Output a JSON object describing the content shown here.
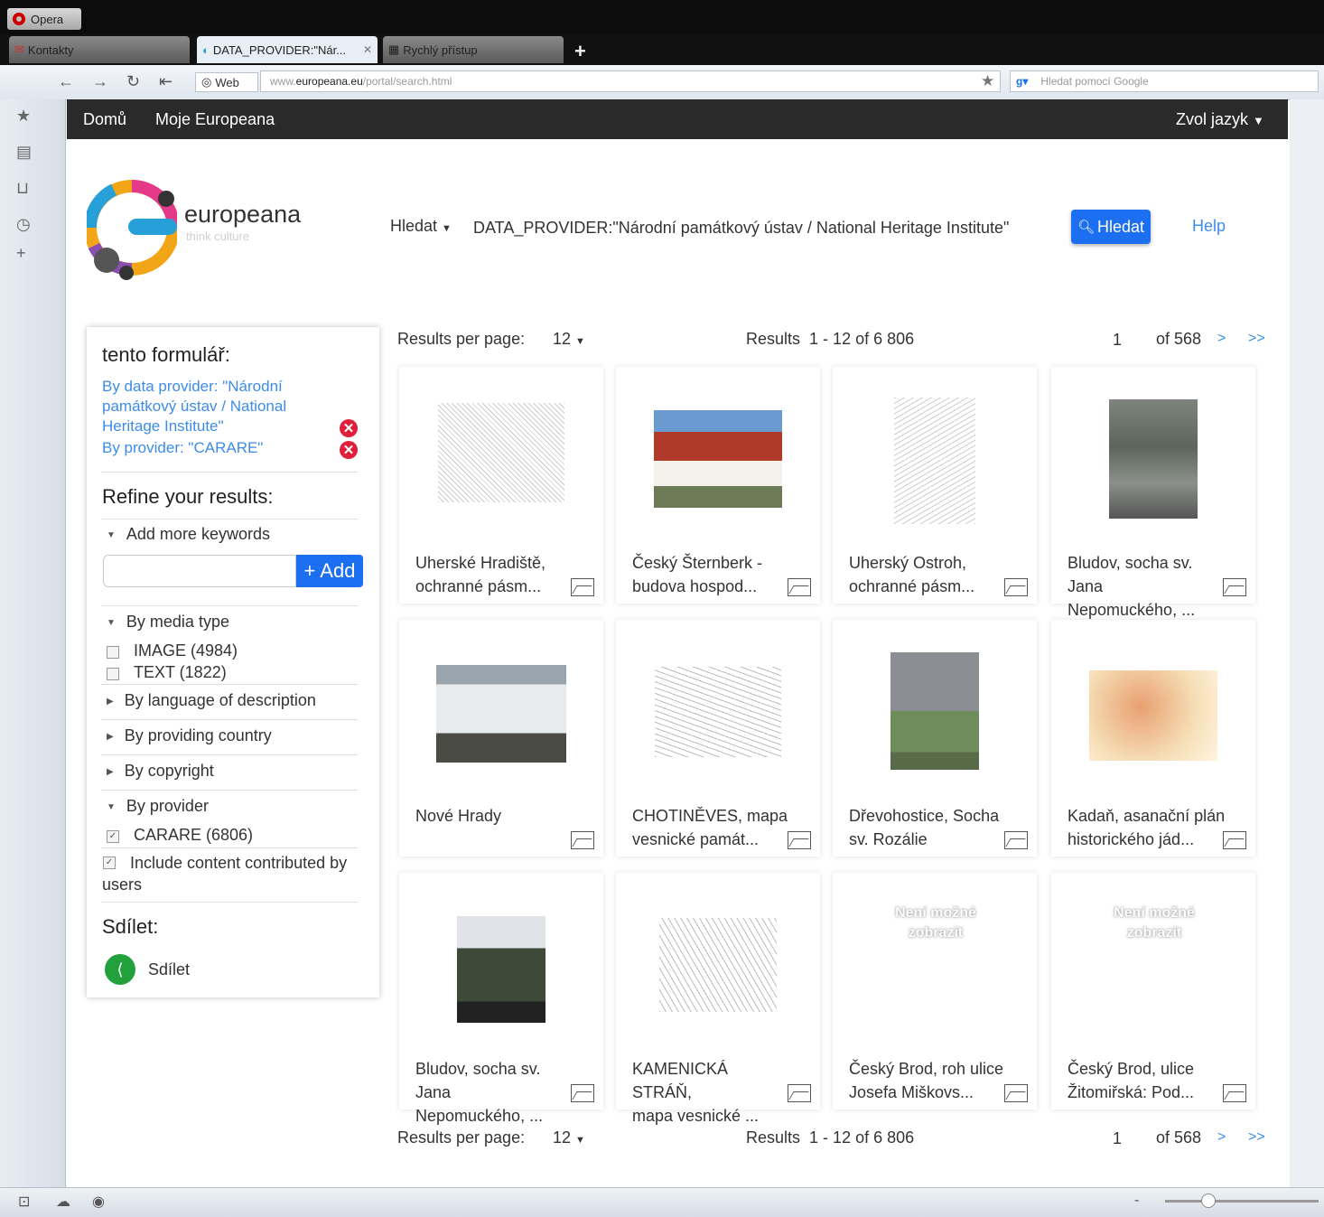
{
  "browser": {
    "app_name": "Opera",
    "tabs": [
      {
        "label": "Kontakty"
      },
      {
        "label": "DATA_PROVIDER:\"Nár..."
      },
      {
        "label": "Rychlý přístup"
      }
    ],
    "web_badge": "Web",
    "url_prefix": "www.",
    "url_domain": "europeana.eu",
    "url_path": "/portal/search.html",
    "search_placeholder": "Hledat pomocí Google"
  },
  "sitenav": {
    "home": "Domů",
    "my": "Moje Europeana",
    "language": "Zvol jazyk"
  },
  "logo": {
    "word": "europeana",
    "tagline": "think culture"
  },
  "search": {
    "scope_label": "Hledat",
    "query": "DATA_PROVIDER:\"Národní památkový ústav / National Heritage Institute\"",
    "button": "Hledat",
    "help": "Help"
  },
  "left_panel": {
    "form_title": "tento formulář:",
    "filter_1": "By data provider: \"Národní památkový ústav / National Heritage Institute\"",
    "filter_2": "By provider: \"CARARE\"",
    "refine_title": "Refine your results:",
    "add_keywords": "Add more keywords",
    "add_button": "+ Add",
    "media_type": "By media type",
    "image_opt": "IMAGE (4984)",
    "text_opt": "TEXT (1822)",
    "language": "By language of description",
    "country": "By providing country",
    "copyright": "By copyright",
    "provider": "By provider",
    "carare_opt": "CARARE (6806)",
    "include_ugc": "Include content contributed by users",
    "share_title": "Sdílet:",
    "share_button": "Sdílet"
  },
  "results": {
    "per_page_label": "Results per page:",
    "per_page_value": "12",
    "results_label": "Results",
    "range": "1 - 12 of 6 806",
    "page": "1",
    "of_pages": "of 568",
    "next": ">",
    "last": ">>",
    "items": [
      {
        "title_1": "Uherské Hradiště,",
        "title_2": "ochranné pásm..."
      },
      {
        "title_1": "Český Šternberk -",
        "title_2": "budova hospod..."
      },
      {
        "title_1": "Uherský Ostroh,",
        "title_2": "ochranné pásm..."
      },
      {
        "title_1": "Bludov, socha sv. Jana",
        "title_2": "Nepomuckého, ..."
      },
      {
        "title_1": "Nové Hrady",
        "title_2": ""
      },
      {
        "title_1": "CHOTINĚVES, mapa",
        "title_2": "vesnické památ..."
      },
      {
        "title_1": "Dřevohostice, Socha",
        "title_2": "sv. Rozálie"
      },
      {
        "title_1": "Kadaň, asanační plán",
        "title_2": "historického jád..."
      },
      {
        "title_1": "Bludov, socha sv. Jana",
        "title_2": "Nepomuckého, ..."
      },
      {
        "title_1": "KAMENICKÁ STRÁŇ,",
        "title_2": "mapa vesnické ..."
      },
      {
        "title_1": "Český Brod, roh ulice",
        "title_2": "Josefa Miškovs..."
      },
      {
        "title_1": "Český Brod, ulice",
        "title_2": "Žitomiřská: Pod..."
      }
    ],
    "no_image_line_1": "Není možné",
    "no_image_line_2": "zobrazit"
  }
}
